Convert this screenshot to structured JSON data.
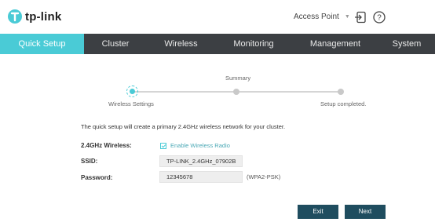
{
  "header": {
    "brand": "tp-link",
    "mode_label": "Access Point",
    "logout_icon": "logout-icon",
    "help_icon": "help-icon"
  },
  "nav": {
    "items": [
      {
        "label": "Quick Setup",
        "active": true
      },
      {
        "label": "Cluster",
        "active": false
      },
      {
        "label": "Wireless",
        "active": false
      },
      {
        "label": "Monitoring",
        "active": false
      },
      {
        "label": "Management",
        "active": false
      },
      {
        "label": "System",
        "active": false
      }
    ]
  },
  "steps": {
    "step1": "Wireless Settings",
    "step2": "Summary",
    "step3": "Setup completed.",
    "current": 1
  },
  "form": {
    "description": "The quick setup will create a primary 2.4GHz wireless network for your cluster.",
    "wireless_label": "2.4GHz Wireless:",
    "enable_label": "Enable Wireless Radio",
    "enabled": true,
    "ssid_label": "SSID:",
    "ssid_value": "TP-LINK_2.4GHz_07902B",
    "password_label": "Password:",
    "password_value": "12345678",
    "security_suffix": "(WPA2-PSK)"
  },
  "buttons": {
    "exit": "Exit",
    "next": "Next"
  },
  "colors": {
    "accent": "#4acbd6",
    "nav_bg": "#3c3f43",
    "button_bg": "#1f4d5f"
  }
}
